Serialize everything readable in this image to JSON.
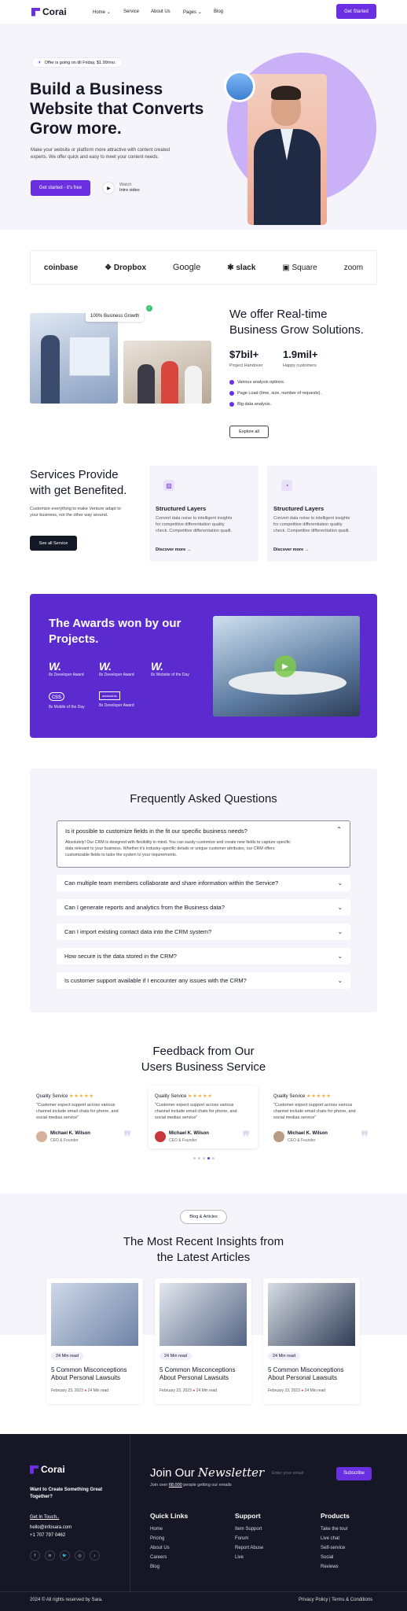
{
  "nav": {
    "brand": "Corai",
    "items": [
      "Home",
      "Service",
      "About Us",
      "Pages",
      "Blog"
    ],
    "cta": "Get Started"
  },
  "hero": {
    "offer": "Offer is going on till Friday, $1.99/mo.",
    "title_line1": "Build a Business",
    "title_line2": "Website that Converts",
    "title_line3": "Grow more.",
    "desc_line1": "Make your website or platform more attractive with content created",
    "desc_line2": "experts. We offer quick and easy to meet your content needs.",
    "primary_cta": "Get started - it's free",
    "watch_label": "Watch",
    "watch_sub": "Intro video"
  },
  "brands": [
    "coinbase",
    "Dropbox",
    "Google",
    "slack",
    "Square",
    "zoom"
  ],
  "growth": {
    "badge": "100% Business Growth",
    "title_line1": "We offer Real-time",
    "title_line2": "Business Grow Solutions.",
    "stat1_value": "$7bil+",
    "stat1_label": "Project Handover",
    "stat2_value": "1.9mil+",
    "stat2_label": "Happy customers",
    "features": [
      "Various analysis options.",
      "Page Load (time, size, number of requests).",
      "Big data analysis."
    ],
    "cta": "Explore all"
  },
  "services": {
    "title_line1": "Services Provide",
    "title_line2": "with get Benefited.",
    "desc_line1": "Customize everything to make Venture adapt to",
    "desc_line2": "your business, not the other way around.",
    "cta": "See all Service",
    "cards": [
      {
        "title": "Structured Layers",
        "l1": "Convert data noise to intelligent insights",
        "l2": "for competitive differentiation quality",
        "l3": "check. Competitive differentiation quailt.",
        "link": "Discover more"
      },
      {
        "title": "Structured Layers",
        "l1": "Convert data noise to intelligent insights",
        "l2": "for competitive differentiation quality",
        "l3": "check. Competitive differentiation quailt.",
        "link": "Discover more"
      }
    ]
  },
  "awards": {
    "title_line1": "The Awards won by our",
    "title_line2": "Projects.",
    "items": [
      {
        "logo": "W.",
        "label": "8x Developer Award"
      },
      {
        "logo": "W.",
        "label": "8x Developer Award"
      },
      {
        "logo": "W.",
        "label": "8x Website of the Day"
      },
      {
        "logo": "css",
        "label": "8x Mobile of the Day"
      },
      {
        "logo": "awwwards",
        "label": "8x Developer Award"
      }
    ]
  },
  "faq": {
    "title": "Frequently Asked Questions",
    "open_question": "Is it possible to customize fields in the fit our specific business needs?",
    "answer_line1": "Absolutely! Our CRM is designed with flexibility in mind. You can easily customize and create new fields to capture specific",
    "answer_line2": "data relevant to your business. Whether it's industry-specific details or unique customer attributes, our CRM offers",
    "answer_line3": "customizable fields to tailor the system to your requirements.",
    "questions": [
      "Can multiple team members collaborate and share information within the Service?",
      "Can I generate reports and analytics from the Business data?",
      "Can I import existing contact data into the CRM system?",
      "How secure is the data stored in the CRM?",
      "Is customer support available if I encounter any issues with the CRM?"
    ]
  },
  "feedback": {
    "title_line1": "Feedback from Our",
    "title_line2": "Users Business Service",
    "cards": [
      {
        "label": "Quality Service",
        "stars": "★★★★★",
        "q1": "\"Customer expect support across various",
        "q2": "channel include email chats for phone, and",
        "q3": "social medias service\"",
        "name": "Michael K. Wilson",
        "role": "CEO & Founder"
      },
      {
        "label": "Quality Service",
        "stars": "★★★★★",
        "q1": "\"Customer expect support across various",
        "q2": "channel include email chats for phone, and",
        "q3": "social medias service\"",
        "name": "Michael K. Wilson",
        "role": "CEO & Founder"
      },
      {
        "label": "Quality Service",
        "stars": "★★★★★",
        "q1": "\"Customer expect support across various",
        "q2": "channel include email chats for phone, and",
        "q3": "social medias service\"",
        "name": "Michael K. Wilson",
        "role": "CEO & Founder"
      }
    ]
  },
  "blog": {
    "badge": "Blog & Articles",
    "title_line1": "The Most Recent Insights from",
    "title_line2": "the Latest Articles",
    "posts": [
      {
        "tag": "24 Min read",
        "t1": "5 Common Misconceptions",
        "t2": "About Personal Lawsuits",
        "date": "February 23, 2023",
        "read": "24 Min read"
      },
      {
        "tag": "24 Min read",
        "t1": "5 Common Misconceptions",
        "t2": "About Personal Lawsuits",
        "date": "February 23, 2023",
        "read": "24 Min read"
      },
      {
        "tag": "24 Min read",
        "t1": "5 Common Misconceptions",
        "t2": "About Personal Lawsuits",
        "date": "February 23, 2023",
        "read": "24 Min read"
      }
    ]
  },
  "footer": {
    "brand": "Corai",
    "tagline_line1": "Want to Create Something Great",
    "tagline_line2": "Together?",
    "touch": "Get In Touch..",
    "email": "hello@infosara.com",
    "phone": "+1 707 797 0462",
    "newsletter_title": "Join Our",
    "newsletter_title_em": "Newsletter",
    "newsletter_sub_pre": "Join over",
    "newsletter_sub_count": "68,000",
    "newsletter_sub_post": "people getting our emails",
    "email_placeholder": "Enter your email",
    "subscribe": "Subscribe",
    "col1_title": "Quick Links",
    "col1": [
      "Home",
      "Pricing",
      "About Us",
      "Careers",
      "Blog"
    ],
    "col2_title": "Support",
    "col2": [
      "Item Support",
      "Forum",
      "Report Abuse",
      "Live"
    ],
    "col3_title": "Products",
    "col3": [
      "Take the tour",
      "Live chat",
      "Self-service",
      "Social",
      "Reviews"
    ],
    "copyright": "2024 © All rights reserved by Sara.",
    "privacy": "Privacy Policy",
    "terms": "Terms & Conditions"
  },
  "colors": {
    "accent": "#6a2fe0",
    "dark": "#151726",
    "soft_bg": "#f5f4fb"
  }
}
